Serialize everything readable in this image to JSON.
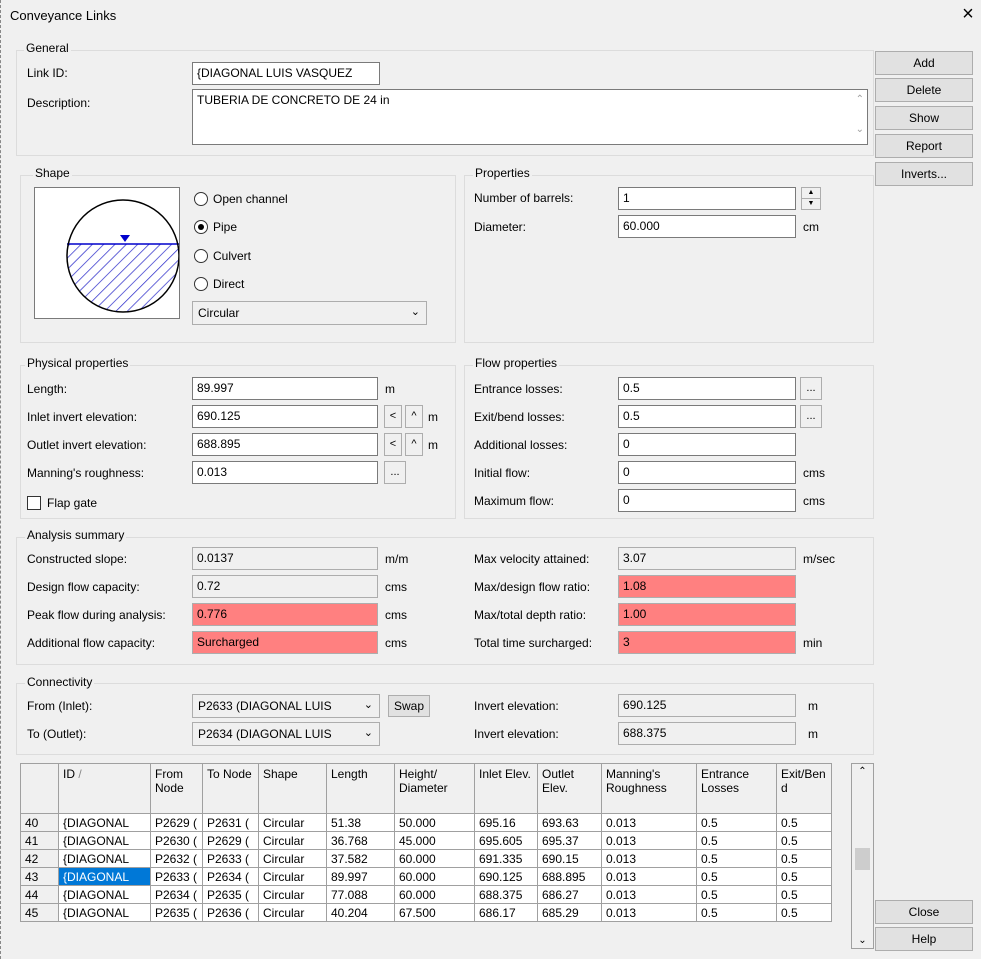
{
  "window": {
    "title": "Conveyance Links",
    "close_glyph": "×"
  },
  "side_buttons": {
    "add": "Add",
    "delete": "Delete",
    "show": "Show",
    "report": "Report",
    "inverts": "Inverts...",
    "close": "Close",
    "help": "Help"
  },
  "general": {
    "title": "General",
    "link_id_label": "Link ID:",
    "link_id_value": "{DIAGONAL LUIS VASQUEZ",
    "description_label": "Description:",
    "description_value": "TUBERIA DE CONCRETO DE 24 in"
  },
  "shape": {
    "title": "Shape",
    "options": [
      "Open channel",
      "Pipe",
      "Culvert",
      "Direct"
    ],
    "selected": "Pipe",
    "section_value": "Circular"
  },
  "properties": {
    "title": "Properties",
    "barrels_label": "Number of barrels:",
    "barrels_value": "1",
    "diameter_label": "Diameter:",
    "diameter_value": "60.000",
    "diameter_unit": "cm"
  },
  "physical": {
    "title": "Physical properties",
    "length_label": "Length:",
    "length_value": "89.997",
    "length_unit": "m",
    "inlet_label": "Inlet invert elevation:",
    "inlet_value": "690.125",
    "outlet_label": "Outlet invert elevation:",
    "outlet_value": "688.895",
    "elev_unit": "m",
    "manning_label": "Manning's roughness:",
    "manning_value": "0.013",
    "flap_label": "Flap gate",
    "ellipsis": "...",
    "left_arrow": "<",
    "up_arrow": "^"
  },
  "flow": {
    "title": "Flow properties",
    "entrance_label": "Entrance losses:",
    "entrance_value": "0.5",
    "exit_label": "Exit/bend losses:",
    "exit_value": "0.5",
    "additional_label": "Additional losses:",
    "additional_value": "0",
    "initial_label": "Initial flow:",
    "initial_value": "0",
    "max_label": "Maximum flow:",
    "max_value": "0",
    "unit": "cms"
  },
  "analysis": {
    "title": "Analysis summary",
    "slope_label": "Constructed slope:",
    "slope_value": "0.0137",
    "slope_unit": "m/m",
    "design_label": "Design flow capacity:",
    "design_value": "0.72",
    "design_unit": "cms",
    "peak_label": "Peak flow during analysis:",
    "peak_value": "0.776",
    "peak_unit": "cms",
    "addcap_label": "Additional flow capacity:",
    "addcap_value": "Surcharged",
    "addcap_unit": "cms",
    "maxvel_label": "Max velocity attained:",
    "maxvel_value": "3.07",
    "maxvel_unit": "m/sec",
    "ratio_label": "Max/design flow ratio:",
    "ratio_value": "1.08",
    "depth_label": "Max/total depth ratio:",
    "depth_value": "1.00",
    "surch_label": "Total time surcharged:",
    "surch_value": "3",
    "surch_unit": "min",
    "highlight_color": "#ff8080"
  },
  "connectivity": {
    "title": "Connectivity",
    "from_label": "From (Inlet):",
    "from_value": "P2633 (DIAGONAL LUIS",
    "to_label": "To (Outlet):",
    "to_value": "P2634 (DIAGONAL LUIS",
    "swap_label": "Swap",
    "inv_label": "Invert elevation:",
    "from_inv_value": "690.125",
    "to_inv_value": "688.375",
    "inv_unit": "m"
  },
  "table": {
    "columns": [
      "",
      "ID",
      "From Node",
      "To Node",
      "Shape",
      "Length",
      "Height/ Diameter",
      "Inlet Elev.",
      "Outlet Elev.",
      "Manning's Roughness",
      "Entrance Losses",
      "Exit/Ben d"
    ],
    "sort_glyph": "/",
    "rows": [
      [
        "40",
        "{DIAGONAL",
        "P2629 (",
        "P2631 (",
        "Circular",
        "51.38",
        "50.000",
        "695.16",
        "693.63",
        "0.013",
        "0.5",
        "0.5"
      ],
      [
        "41",
        "{DIAGONAL",
        "P2630 (",
        "P2629 (",
        "Circular",
        "36.768",
        "45.000",
        "695.605",
        "695.37",
        "0.013",
        "0.5",
        "0.5"
      ],
      [
        "42",
        "{DIAGONAL",
        "P2632 (",
        "P2633 (",
        "Circular",
        "37.582",
        "60.000",
        "691.335",
        "690.15",
        "0.013",
        "0.5",
        "0.5"
      ],
      [
        "43",
        "{DIAGONAL",
        "P2633 (",
        "P2634 (",
        "Circular",
        "89.997",
        "60.000",
        "690.125",
        "688.895",
        "0.013",
        "0.5",
        "0.5"
      ],
      [
        "44",
        "{DIAGONAL",
        "P2634 (",
        "P2635 (",
        "Circular",
        "77.088",
        "60.000",
        "688.375",
        "686.27",
        "0.013",
        "0.5",
        "0.5"
      ],
      [
        "45",
        "{DIAGONAL",
        "P2635 (",
        "P2636 (",
        "Circular",
        "40.204",
        "67.500",
        "686.17",
        "685.29",
        "0.013",
        "0.5",
        "0.5"
      ]
    ],
    "selected_row": 3,
    "selection_color": "#0078d7"
  }
}
